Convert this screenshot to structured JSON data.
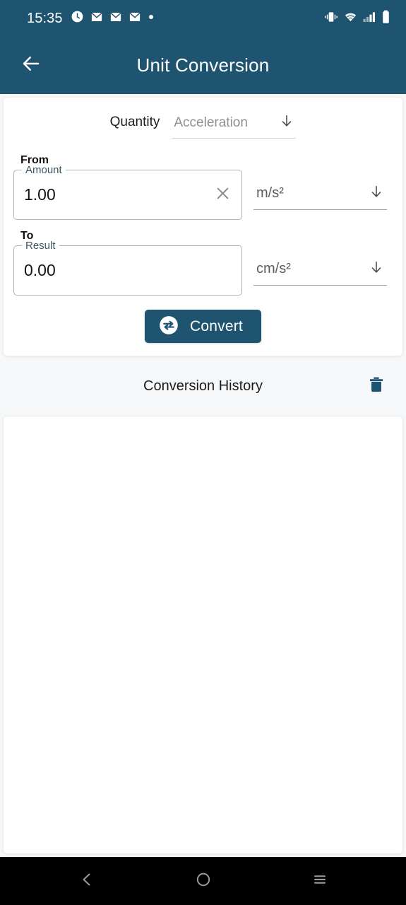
{
  "status_bar": {
    "time": "15:35",
    "left_icons": [
      "clock-icon",
      "mail-icon",
      "mail-icon",
      "mail-icon",
      "dot-icon"
    ],
    "right_icons": [
      "vibrate-icon",
      "wifi-icon",
      "cellular-signal-icon",
      "battery-icon"
    ]
  },
  "app_bar": {
    "back_icon": "arrow-left-icon",
    "title": "Unit Conversion"
  },
  "converter": {
    "quantity": {
      "label": "Quantity",
      "selected": "Acceleration",
      "dropdown_icon": "arrow-down-icon"
    },
    "from": {
      "section_label": "From",
      "field_label": "Amount",
      "value": "1.00",
      "clear_icon": "close-icon",
      "unit": "m/s²",
      "unit_dropdown_icon": "arrow-down-icon"
    },
    "to": {
      "section_label": "To",
      "field_label": "Result",
      "value": "0.00",
      "unit": "cm/s²",
      "unit_dropdown_icon": "arrow-down-icon"
    },
    "convert_button": {
      "label": "Convert",
      "icon": "swap-horizontal-icon"
    }
  },
  "history": {
    "title": "Conversion History",
    "clear_icon": "trash-icon",
    "entries": []
  },
  "nav_bar": {
    "back": "back-chevron-icon",
    "home": "home-circle-icon",
    "recents": "recent-apps-icon"
  },
  "colors": {
    "primary": "#1e5470",
    "page_background": "#f7f8f9",
    "card_background": "#ffffff",
    "nav_background": "#000000",
    "muted_text": "#8f8f8f"
  }
}
